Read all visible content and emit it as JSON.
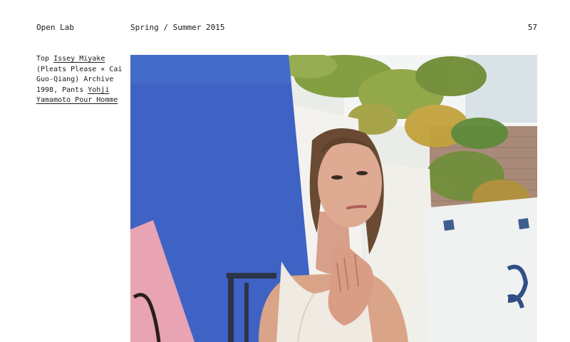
{
  "header": {
    "site_name": "Open Lab",
    "issue_title": "Spring / Summer 2015",
    "page_number": "57"
  },
  "caption": {
    "prefix": "Top ",
    "link1": "Issey Miyake",
    "middle": " (Pleats Please × Cai Guo-Qiang) Archive 1998, Pants ",
    "link2": "Yohji Yamamoto Pour Homme"
  },
  "photo": {
    "subject": "fashion-editorial-photo"
  },
  "colors": {
    "blue_wall": "#3f63c4",
    "pink_panel": "#e8a4b2",
    "foliage": "#7f9a3a"
  }
}
